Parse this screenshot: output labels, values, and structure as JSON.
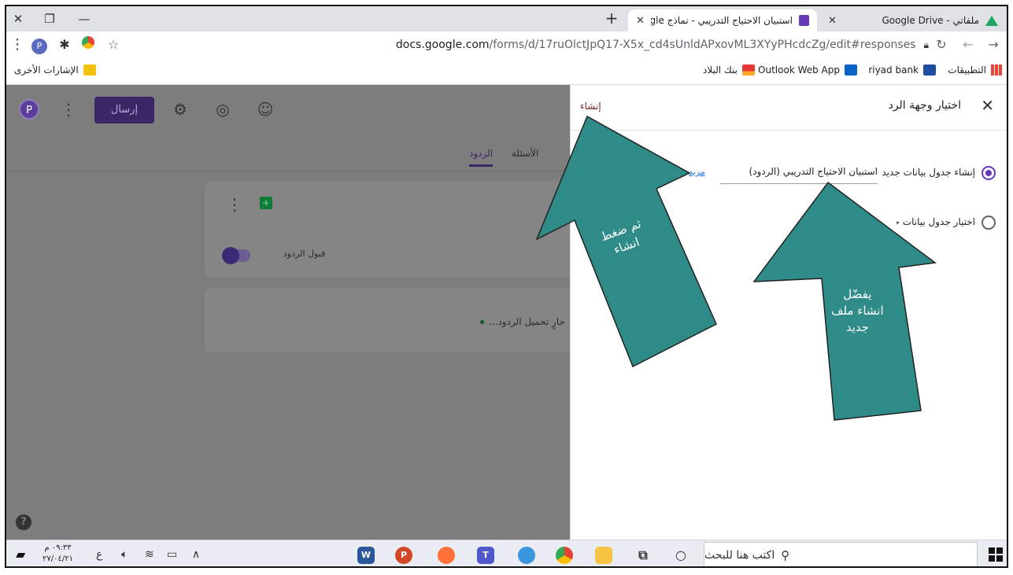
{
  "browser": {
    "tabs": [
      {
        "title": "ملفاتي - Google Drive",
        "active": false
      },
      {
        "title": "استبيان الاحتياج التدريبي - نماذج Google",
        "active": true
      }
    ],
    "url_domain": "docs.google.com",
    "url_path": "/forms/d/17ruOlctJpQ17-X5x_cd4sUnldAPxovML3XYyPHcdcZg/edit#responses",
    "profile_letter": "P"
  },
  "bookmarks": {
    "apps": "التطبيقات",
    "items": [
      "riyad bank",
      "Outlook Web App",
      "بنك البلاد"
    ],
    "other": "الإشارات الأخرى"
  },
  "forms": {
    "avatar_letter": "P",
    "send_label": "إرسال",
    "tab_questions": "الأسئلة",
    "tab_responses": "الردود",
    "accept_responses": "قبول الردود",
    "loading_text": "جارٍ تحميل الردود..."
  },
  "panel": {
    "title": "اختيار وجهة الرد",
    "create_label": "إنشاء",
    "option_new": "إنشاء جدول بيانات جديد",
    "new_sheet_name": "استبيان الاحتياج التدريبي (الردود)",
    "learn_more": "مزيد",
    "option_existing": "اختيار جدول بيانات حالي"
  },
  "annotations": {
    "arrow_left_line1": "ثم ضغط",
    "arrow_left_line2": "انشاء",
    "arrow_right_line1": "يفضّل",
    "arrow_right_line2": "انشاء ملف",
    "arrow_right_line3": "جديد",
    "fill_color": "#2e8b87"
  },
  "taskbar": {
    "search_placeholder": "اكتب هنا للبحث",
    "time": "٠٩:٣٣ م",
    "date": "٢٧/٠٤/٢١",
    "lang": "ع"
  },
  "colors": {
    "accent": "#673ab7",
    "send_button": "#3b2666"
  }
}
